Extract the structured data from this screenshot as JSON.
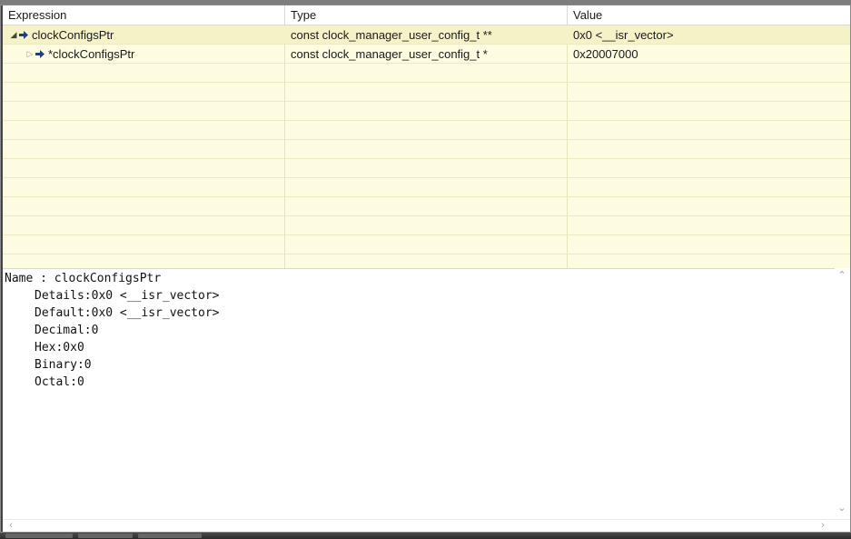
{
  "background_text": "",
  "columns": {
    "expression": "Expression",
    "type": "Type",
    "value": "Value"
  },
  "rows": [
    {
      "toggle_icon": "expanded-triangle",
      "expression": "clockConfigsPtr",
      "type": "const clock_manager_user_config_t **",
      "value": "0x0 <__isr_vector>"
    },
    {
      "toggle_icon": "collapsed-triangle",
      "expression": "*clockConfigsPtr",
      "type": "const clock_manager_user_config_t *",
      "value": "0x20007000"
    }
  ],
  "details": {
    "name_line": "Name : clockConfigsPtr",
    "lines": [
      "Details:0x0 <__isr_vector>",
      "Default:0x0 <__isr_vector>",
      "Decimal:0",
      "Hex:0x0",
      "Binary:0",
      "Octal:0"
    ]
  },
  "colors": {
    "table_background": "#fdfbe0",
    "variable_icon": "#1f3f7a"
  }
}
